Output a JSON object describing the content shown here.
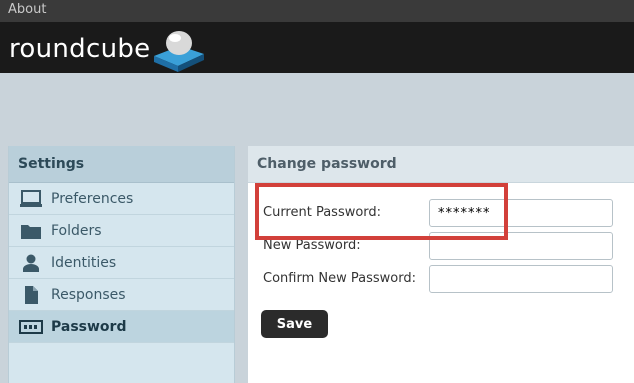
{
  "topbar": {
    "about": "About"
  },
  "header": {
    "logo_text": "roundcube"
  },
  "sidebar": {
    "title": "Settings",
    "items": [
      {
        "label": "Preferences",
        "icon": "monitor-icon"
      },
      {
        "label": "Folders",
        "icon": "folder-icon"
      },
      {
        "label": "Identities",
        "icon": "person-icon"
      },
      {
        "label": "Responses",
        "icon": "document-icon"
      },
      {
        "label": "Password",
        "icon": "password-icon",
        "active": true
      }
    ]
  },
  "panel": {
    "title": "Change password",
    "fields": [
      {
        "label": "Current Password:",
        "value": "*******"
      },
      {
        "label": "New Password:",
        "value": ""
      },
      {
        "label": "Confirm New Password:",
        "value": ""
      }
    ],
    "save_label": "Save"
  },
  "colors": {
    "header_bg": "#1a1a1a",
    "sidebar_bg": "#d5e6ee",
    "highlight_border": "#d2403a",
    "save_button_bg": "#2b2b2b"
  }
}
